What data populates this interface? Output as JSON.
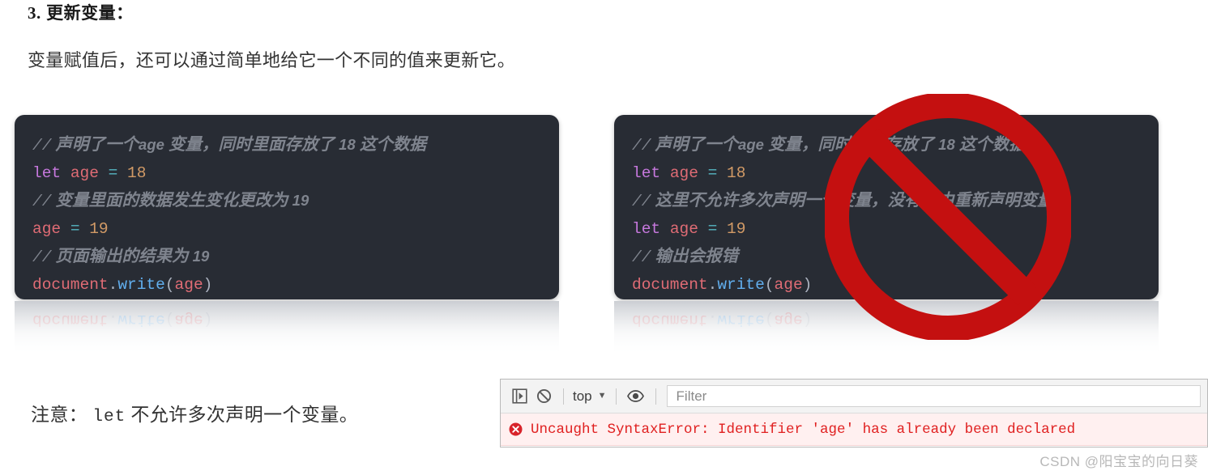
{
  "heading": {
    "number": "3.",
    "text": "更新变量："
  },
  "paragraph": "变量赋值后，还可以通过简单地给它一个不同的值来更新它。",
  "note": {
    "prefix": "注意：",
    "keyword": "let",
    "suffix": "不允许多次声明一个变量。"
  },
  "code_left": {
    "lines": [
      {
        "type": "comment",
        "slashes": "//",
        "text_a": "声明了一个",
        "latin": "age",
        "text_b": "变量，同时里面存放了",
        "num": "18",
        "text_c": "这个数据"
      },
      {
        "type": "code",
        "keyword": "let",
        "variable": "age",
        "operator": "=",
        "number": "18"
      },
      {
        "type": "comment",
        "slashes": "//",
        "text_a": "变量里面的数据发生变化更改为",
        "latin": "",
        "text_b": "",
        "num": "19",
        "text_c": ""
      },
      {
        "type": "code",
        "keyword": "",
        "variable": "age",
        "operator": "=",
        "number": "19"
      },
      {
        "type": "comment",
        "slashes": "//",
        "text_a": "页面输出的结果为",
        "latin": "",
        "text_b": "",
        "num": "19",
        "text_c": ""
      },
      {
        "type": "call",
        "object": "document",
        "dot": ".",
        "method": "write",
        "open": "(",
        "argument": "age",
        "close": ")"
      }
    ],
    "reflection_text": "document.write(age)"
  },
  "code_right": {
    "lines": [
      {
        "type": "comment",
        "slashes": "//",
        "text_a": "声明了一个",
        "latin": "age",
        "text_b": "变量，同时里面存放了",
        "num": "18",
        "text_c": "这个数据"
      },
      {
        "type": "code",
        "keyword": "let",
        "variable": "age",
        "operator": "=",
        "number": "18"
      },
      {
        "type": "comment",
        "slashes": "//",
        "text_a": "这里不允许多次声明一个变量，没有理由重新声明变量",
        "latin": "",
        "text_b": "",
        "num": "",
        "text_c": ""
      },
      {
        "type": "code",
        "keyword": "let",
        "variable": "age",
        "operator": "=",
        "number": "19"
      },
      {
        "type": "comment",
        "slashes": "//",
        "text_a": "输出会报错",
        "latin": "",
        "text_b": "",
        "num": "",
        "text_c": ""
      },
      {
        "type": "call",
        "object": "document",
        "dot": ".",
        "method": "write",
        "open": "(",
        "argument": "age",
        "close": ")"
      }
    ],
    "reflection_text": "document.write(age)"
  },
  "prohibition_sign": {
    "icon": "no-entry-icon",
    "color": "#c41010"
  },
  "devtools": {
    "toolbar": {
      "sidebar_toggle_icon": "console-sidebar-icon",
      "clear_icon": "clear-console-icon",
      "context_label": "top",
      "caret_icon": "chevron-down-icon",
      "eye_icon": "live-expression-eye-icon",
      "filter_placeholder": "Filter",
      "filter_value": ""
    },
    "error": {
      "icon": "error-circle-icon",
      "message": "Uncaught SyntaxError: Identifier 'age' has already been declared",
      "color": "#e02020",
      "background": "#fff0f0"
    }
  },
  "watermark": "CSDN @阳宝宝的向日葵",
  "theme": {
    "code_background": "#282c34",
    "keyword": "#c678dd",
    "variable": "#e06c75",
    "operator": "#56b6c2",
    "number": "#d19a66",
    "function": "#61afef",
    "comment": "#7f848e",
    "punctuation": "#abb2bf"
  }
}
